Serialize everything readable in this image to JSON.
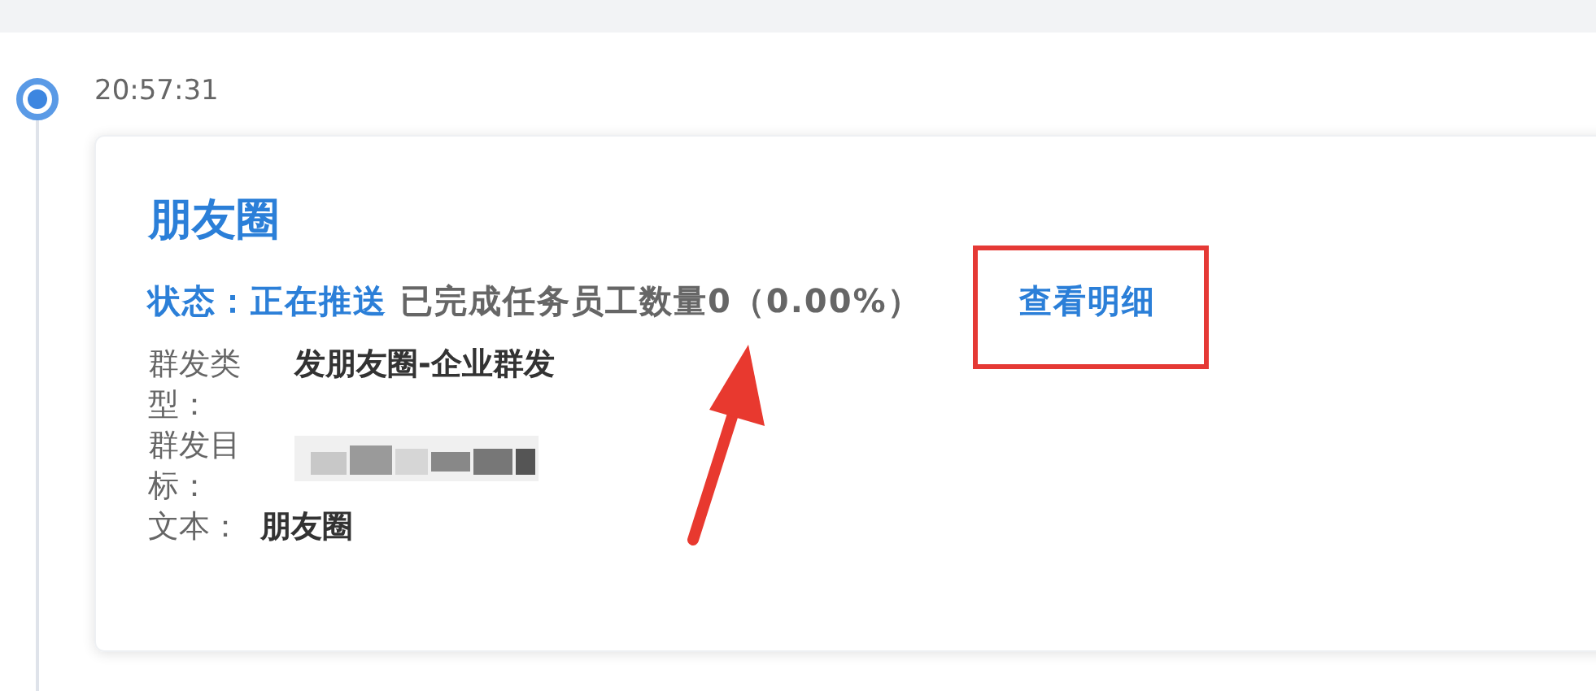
{
  "timeline": {
    "time": "20:57:31",
    "card": {
      "title": "朋友圈",
      "status_label": "状态：",
      "status_value": "正在推送",
      "progress": "已完成任务员工数量0（0.00%）",
      "detail_link": "查看明细",
      "fields": [
        {
          "label": "群发类型：",
          "value": "发朋友圈-企业群发",
          "kind": "text"
        },
        {
          "label": "群发目标：",
          "kind": "redacted"
        },
        {
          "label": "文本：",
          "value": "朋友圈",
          "kind": "text"
        }
      ]
    }
  },
  "annotations": {
    "highlight_frame": true,
    "arrow": true
  }
}
